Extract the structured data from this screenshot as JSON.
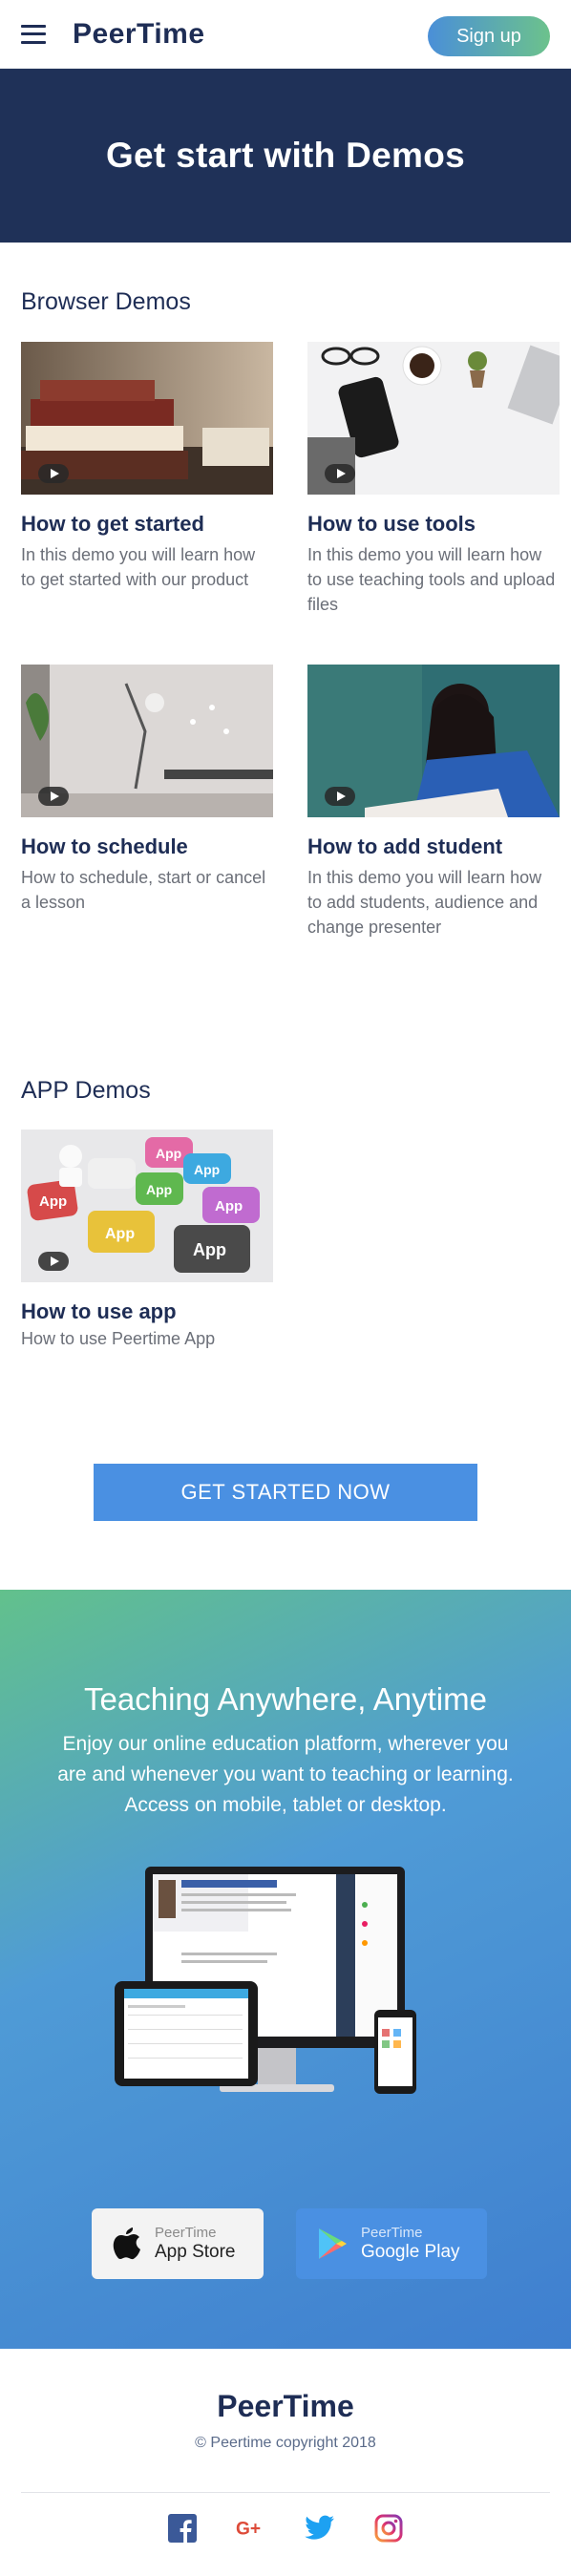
{
  "header": {
    "logo": "PeerTime",
    "signup_label": "Sign up"
  },
  "hero": {
    "title": "Get start with Demos"
  },
  "browser_demos": {
    "title": "Browser Demos",
    "cards": [
      {
        "title": "How to get started",
        "desc": "In this demo you will learn how to get started with our product"
      },
      {
        "title": "How to use tools",
        "desc": "In this demo you will learn how to use teaching tools and upload files"
      },
      {
        "title": "How to schedule",
        "desc": "How to schedule, start or cancel a lesson"
      },
      {
        "title": "How to add student",
        "desc": "In this demo you will learn how to add students, audience and change presenter"
      }
    ]
  },
  "app_demos": {
    "title": "APP Demos",
    "cards": [
      {
        "title": "How to use app",
        "desc": "How to use Peertime App"
      }
    ],
    "thumb_key_labels": [
      "App",
      "App",
      "App",
      "App",
      "App",
      "App",
      "App"
    ]
  },
  "cta": {
    "label": "GET STARTED NOW"
  },
  "promo": {
    "title": "Teaching Anywhere, Anytime",
    "desc": "Enjoy our online education platform, wherever you are and whenever you want to teaching or learning. Access on mobile, tablet or desktop.",
    "app_store": {
      "small": "PeerTime",
      "big": "App Store"
    },
    "google_play": {
      "small": "PeerTime",
      "big": "Google Play"
    }
  },
  "footer": {
    "logo": "PeerTime",
    "copyright": "© Peertime copyright 2018",
    "social": [
      "facebook-icon",
      "google-plus-icon",
      "twitter-icon",
      "instagram-icon"
    ]
  },
  "colors": {
    "navy": "#1e2d55",
    "hero_bg": "#1f3158",
    "accent_blue": "#4a90e2",
    "accent_green": "#6cc28c"
  }
}
